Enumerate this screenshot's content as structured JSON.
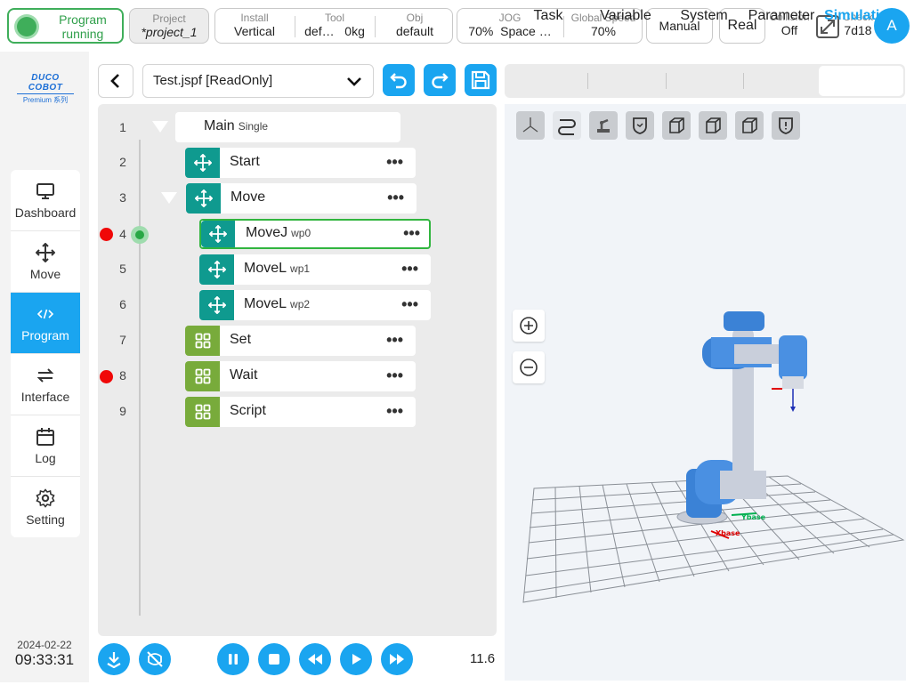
{
  "status": {
    "line1": "Program",
    "line2": "running",
    "color": "#3fae5a"
  },
  "project": {
    "label": "Project",
    "value": "*project_1"
  },
  "install": {
    "install_label": "Install",
    "install_value": "Vertical",
    "tool_label": "Tool",
    "tool_name": "def…",
    "tool_mass": "0kg",
    "obj_label": "Obj",
    "obj_value": "default"
  },
  "jog": {
    "jog_label": "JOG",
    "jog_percent": "70%",
    "jog_space": "Space …",
    "speed_label": "Global Speed",
    "speed_value": "70%"
  },
  "mode": {
    "manual": "Manual",
    "real": "Real"
  },
  "collision": {
    "label": "Collision",
    "value": "Off"
  },
  "check": {
    "label": "Check",
    "value": "7d18"
  },
  "avatar": "A",
  "logo": {
    "main": "DUCO COBOT",
    "sub": "Premium 系列"
  },
  "nav": [
    {
      "label": "Dashboard",
      "icon": "monitor-icon"
    },
    {
      "label": "Move",
      "icon": "move-arrows-icon"
    },
    {
      "label": "Program",
      "icon": "code-icon",
      "active": true
    },
    {
      "label": "Interface",
      "icon": "swap-icon"
    },
    {
      "label": "Log",
      "icon": "calendar-icon"
    },
    {
      "label": "Setting",
      "icon": "gear-icon"
    }
  ],
  "datetime": {
    "date": "2024-02-22",
    "time": "09:33:31"
  },
  "file": {
    "name": "Test.jspf [ReadOnly]"
  },
  "tree": {
    "line_numbers": [
      "1",
      "2",
      "3",
      "4",
      "5",
      "6",
      "7",
      "8",
      "9"
    ],
    "rows": [
      {
        "name": "Main",
        "sub": "Single"
      },
      {
        "name": "Start",
        "sub": ""
      },
      {
        "name": "Move",
        "sub": ""
      },
      {
        "name": "MoveJ",
        "sub": "wp0"
      },
      {
        "name": "MoveL",
        "sub": "wp1"
      },
      {
        "name": "MoveL",
        "sub": "wp2"
      },
      {
        "name": "Set",
        "sub": ""
      },
      {
        "name": "Wait",
        "sub": ""
      },
      {
        "name": "Script",
        "sub": ""
      }
    ],
    "more": "•••"
  },
  "speed_readout": "11.6",
  "tabs": [
    "Task",
    "Variable",
    "System",
    "Parameter",
    "Simulation"
  ],
  "sim_labels": {
    "x": "Xbase",
    "y": "Ybase"
  },
  "colors": {
    "accent": "#1aa5f0",
    "teal": "#0f9a8f",
    "olive": "#78ab3b",
    "breakpoint": "#f00808",
    "robot_blue": "#3b82d6"
  }
}
